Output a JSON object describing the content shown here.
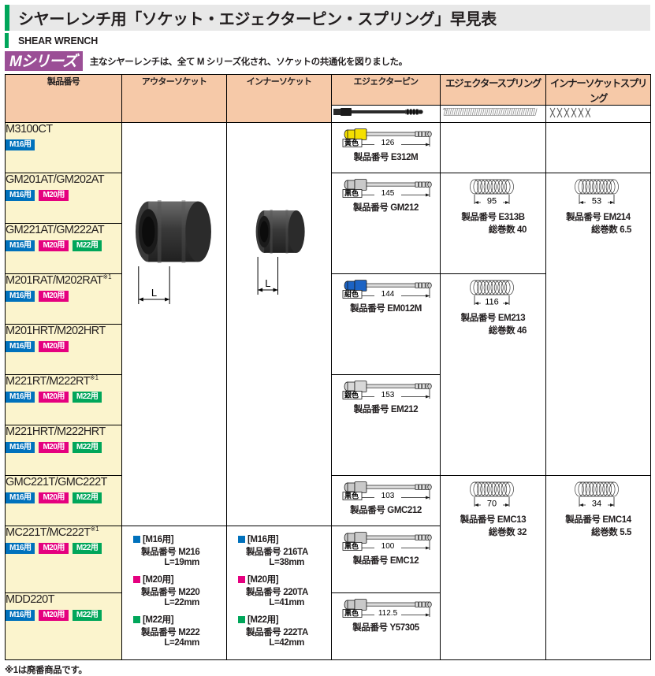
{
  "header": {
    "title": "シヤーレンチ用「ソケット・エジェクターピン・スプリング」早見表",
    "subtitle": "SHEAR WRENCH",
    "series_badge": "Mシリーズ",
    "series_note": "主なシヤーレンチは、全て M シリーズ化され、ソケットの共通化を図りました。",
    "accent_color": "#00a65a",
    "badge_color": "#9b4f96",
    "header_row_color": "#f6c9a8",
    "product_cell_color": "#fbf4cd"
  },
  "columns": [
    {
      "id": "product_no",
      "label": "製品番号"
    },
    {
      "id": "outer_socket",
      "label": "アウターソケット"
    },
    {
      "id": "inner_socket",
      "label": "インナーソケット"
    },
    {
      "id": "ejector_pin",
      "label": "エジェクターピン"
    },
    {
      "id": "ejector_spring",
      "label": "エジェクタースプリング"
    },
    {
      "id": "inner_socket_spring",
      "label": "インナーソケットスプリング"
    }
  ],
  "icon_row": {
    "ejector_pin_icon": "ejector-pin-illustration",
    "ejector_spring_icon": "long-coil-spring-illustration",
    "inner_socket_spring_icon": "short-coil-spring-illustration"
  },
  "products": [
    {
      "name": "M3100CT",
      "footnote_mark": "",
      "tags": [
        "M16用"
      ]
    },
    {
      "name": "GM201AT/GM202AT",
      "footnote_mark": "",
      "tags": [
        "M16用",
        "M20用"
      ]
    },
    {
      "name": "GM221AT/GM222AT",
      "footnote_mark": "",
      "tags": [
        "M16用",
        "M20用",
        "M22用"
      ]
    },
    {
      "name": "M201RAT/M202RAT",
      "footnote_mark": "※1",
      "tags": [
        "M16用",
        "M20用"
      ]
    },
    {
      "name": "M201HRT/M202HRT",
      "footnote_mark": "",
      "tags": [
        "M16用",
        "M20用"
      ]
    },
    {
      "name": "M221RT/M222RT",
      "footnote_mark": "※1",
      "tags": [
        "M16用",
        "M20用",
        "M22用"
      ]
    },
    {
      "name": "M221HRT/M222HRT",
      "footnote_mark": "",
      "tags": [
        "M16用",
        "M20用",
        "M22用"
      ]
    },
    {
      "name": "GMC221T/GMC222T",
      "footnote_mark": "",
      "tags": [
        "M16用",
        "M20用",
        "M22用"
      ]
    },
    {
      "name": "MC221T/MC222T",
      "footnote_mark": "※1",
      "tags": [
        "M16用",
        "M20用",
        "M22用"
      ]
    },
    {
      "name": "MDD220T",
      "footnote_mark": "",
      "tags": [
        "M16用",
        "M20用",
        "M22用"
      ]
    }
  ],
  "labels": {
    "part_no_prefix": "製品番号",
    "coil_count_prefix": "総巻数",
    "length_marker": "L"
  },
  "ejector_pins": [
    {
      "color_label": "黄色",
      "color_hex": "#f5e000",
      "length": "126",
      "part_no": "E312M",
      "rowspan": 1
    },
    {
      "color_label": "黒色",
      "color_hex": "#c9c9c9",
      "length": "145",
      "part_no": "GM212",
      "rowspan": 2
    },
    {
      "color_label": "紺色",
      "color_hex": "#1c63c4",
      "length": "144",
      "part_no": "EM012M",
      "rowspan": 2
    },
    {
      "color_label": "銀色",
      "color_hex": "#d8d8d8",
      "length": "153",
      "part_no": "EM212",
      "rowspan": 2
    },
    {
      "color_label": "黒色",
      "color_hex": "#c9c9c9",
      "length": "103",
      "part_no": "GMC212",
      "rowspan": 1
    },
    {
      "color_label": "黒色",
      "color_hex": "#c9c9c9",
      "length": "100",
      "part_no": "EMC12",
      "rowspan": 1
    },
    {
      "color_label": "黒色",
      "color_hex": "#c9c9c9",
      "length": "112.5",
      "part_no": "Y57305",
      "rowspan": 1
    }
  ],
  "ejector_springs": [
    {
      "empty": true,
      "rowspan": 1
    },
    {
      "empty": false,
      "length": "95",
      "part_no": "E313B",
      "coil_count": "40",
      "rowspan": 2
    },
    {
      "empty": false,
      "length": "116",
      "part_no": "EM213",
      "coil_count": "46",
      "rowspan": 4
    },
    {
      "empty": false,
      "length": "70",
      "part_no": "EMC13",
      "coil_count": "32",
      "rowspan": 3
    }
  ],
  "inner_socket_springs": [
    {
      "empty": true,
      "rowspan": 1
    },
    {
      "empty": false,
      "length": "53",
      "part_no": "EM214",
      "coil_count": "6.5",
      "rowspan": 6
    },
    {
      "empty": false,
      "length": "34",
      "part_no": "EMC14",
      "coil_count": "5.5",
      "rowspan": 3
    }
  ],
  "outer_socket": {
    "image_rowspan": 8,
    "image_alt": "outer-socket-photo",
    "dim_label": "L",
    "specs": [
      {
        "swatch": "m16",
        "head": "[M16用]",
        "part_no": "製品番号  M216",
        "length": "L=19mm"
      },
      {
        "swatch": "m20",
        "head": "[M20用]",
        "part_no": "製品番号  M220",
        "length": "L=22mm"
      },
      {
        "swatch": "m22",
        "head": "[M22用]",
        "part_no": "製品番号  M222",
        "length": "L=24mm"
      }
    ],
    "specs_rowspan": 2
  },
  "inner_socket": {
    "image_rowspan": 8,
    "image_alt": "inner-socket-photo",
    "dim_label": "L",
    "specs": [
      {
        "swatch": "m16",
        "head": "[M16用]",
        "part_no": "製品番号  216TA",
        "length": "L=38mm"
      },
      {
        "swatch": "m20",
        "head": "[M20用]",
        "part_no": "製品番号  220TA",
        "length": "L=41mm"
      },
      {
        "swatch": "m22",
        "head": "[M22用]",
        "part_no": "製品番号  222TA",
        "length": "L=42mm"
      }
    ],
    "specs_rowspan": 2
  },
  "footnote": "※1は廃番商品です。"
}
